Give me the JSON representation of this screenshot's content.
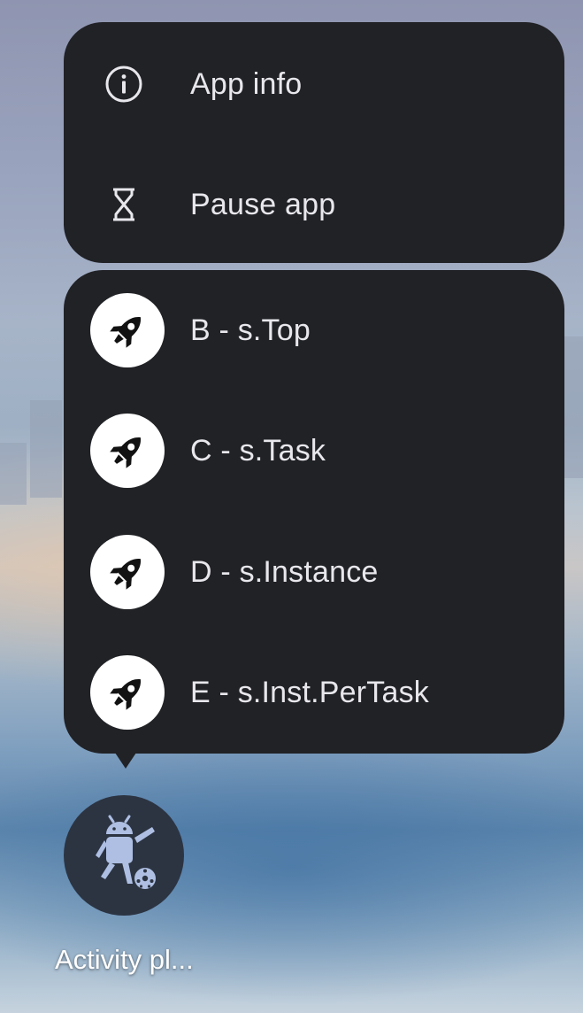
{
  "system_menu": {
    "items": [
      {
        "label": "App info",
        "icon": "info-icon"
      },
      {
        "label": "Pause app",
        "icon": "hourglass-icon"
      }
    ]
  },
  "shortcuts_menu": {
    "items": [
      {
        "label": "B - s.Top",
        "icon": "rocket-icon"
      },
      {
        "label": "C - s.Task",
        "icon": "rocket-icon"
      },
      {
        "label": "D - s.Instance",
        "icon": "rocket-icon"
      },
      {
        "label": "E - s.Inst.PerTask",
        "icon": "rocket-icon"
      }
    ]
  },
  "app": {
    "label": "Activity pl...",
    "icon": "android-soccer-icon"
  },
  "colors": {
    "menu_background": "#212226",
    "menu_text": "#e8e8ec",
    "shortcut_icon_background": "#ffffff",
    "app_icon_background": "#2c3442",
    "android_icon": "#aebfe3"
  }
}
